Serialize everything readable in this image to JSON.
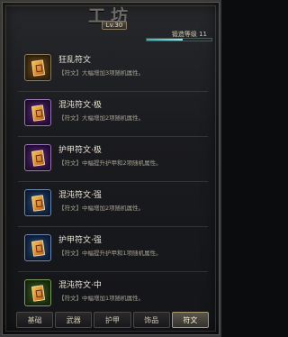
{
  "window": {
    "title": "工坊",
    "level_badge": "Lv.30"
  },
  "forge": {
    "level_text": "锻造等级 11",
    "progress_fraction": 0.55
  },
  "items": [
    {
      "name": "狂乱符文",
      "desc": "【符文】大幅增加3项随机属性。",
      "quality": "orange",
      "icon": "rune-icon"
    },
    {
      "name": "混沌符文·极",
      "desc": "【符文】大幅增加2项随机属性。",
      "quality": "purple",
      "icon": "rune-icon"
    },
    {
      "name": "护甲符文·极",
      "desc": "【符文】中幅提升护甲和2项随机属性。",
      "quality": "purple",
      "icon": "rune-icon"
    },
    {
      "name": "混沌符文·强",
      "desc": "【符文】中幅增加2项随机属性。",
      "quality": "blue",
      "icon": "rune-icon"
    },
    {
      "name": "护甲符文·强",
      "desc": "【符文】中幅提升护甲和1项随机属性。",
      "quality": "blue",
      "icon": "rune-icon"
    },
    {
      "name": "混沌符文·中",
      "desc": "【符文】中幅增加1项随机属性。",
      "quality": "green",
      "icon": "rune-icon"
    }
  ],
  "tabs": [
    {
      "label": "基础",
      "active": false
    },
    {
      "label": "武器",
      "active": false
    },
    {
      "label": "护甲",
      "active": false
    },
    {
      "label": "饰品",
      "active": false
    },
    {
      "label": "符文",
      "active": true
    }
  ],
  "colors": {
    "accent_bar": "#3fb2b8",
    "tab_active_border": "#a89870"
  }
}
